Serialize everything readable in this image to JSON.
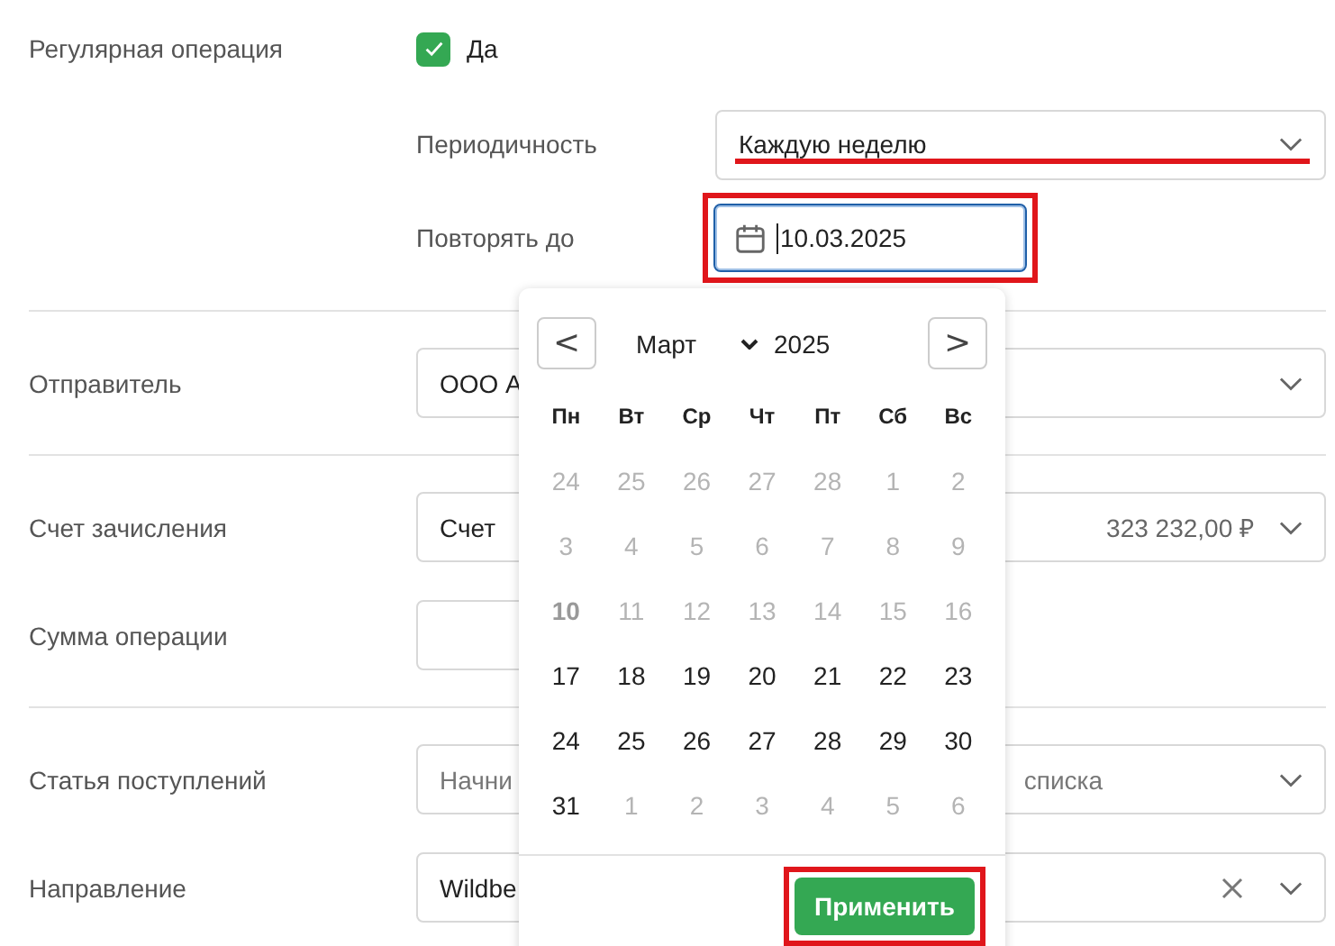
{
  "recurring": {
    "label": "Регулярная операция",
    "checkbox_label": "Да",
    "checked": true
  },
  "periodicity": {
    "label": "Периодичность",
    "value": "Каждую неделю",
    "highlighted": true
  },
  "repeat_until": {
    "label": "Повторять до",
    "value": "10.03.2025",
    "highlighted": true
  },
  "sender": {
    "label": "Отправитель",
    "value": "ООО А"
  },
  "account": {
    "label": "Счет зачисления",
    "value": "Счет",
    "balance": "323 232,00 ₽"
  },
  "amount": {
    "label": "Сумма операции"
  },
  "income_item": {
    "label": "Статья поступлений",
    "placeholder_start": "Начни",
    "placeholder_end": "списка"
  },
  "direction": {
    "label": "Направление",
    "value": "Wildbe"
  },
  "calendar": {
    "prev": "<",
    "month": "Март",
    "year": "2025",
    "next": ">",
    "weekdays": [
      "Пн",
      "Вт",
      "Ср",
      "Чт",
      "Пт",
      "Сб",
      "Вс"
    ],
    "weeks": [
      [
        {
          "day": "24",
          "disabled": true,
          "selected": false
        },
        {
          "day": "25",
          "disabled": true,
          "selected": false
        },
        {
          "day": "26",
          "disabled": true,
          "selected": false
        },
        {
          "day": "27",
          "disabled": true,
          "selected": false
        },
        {
          "day": "28",
          "disabled": true,
          "selected": false
        },
        {
          "day": "1",
          "disabled": true,
          "selected": false
        },
        {
          "day": "2",
          "disabled": true,
          "selected": false
        }
      ],
      [
        {
          "day": "3",
          "disabled": true,
          "selected": false
        },
        {
          "day": "4",
          "disabled": true,
          "selected": false
        },
        {
          "day": "5",
          "disabled": true,
          "selected": false
        },
        {
          "day": "6",
          "disabled": true,
          "selected": false
        },
        {
          "day": "7",
          "disabled": true,
          "selected": false
        },
        {
          "day": "8",
          "disabled": true,
          "selected": false
        },
        {
          "day": "9",
          "disabled": true,
          "selected": false
        }
      ],
      [
        {
          "day": "10",
          "disabled": true,
          "selected": true
        },
        {
          "day": "11",
          "disabled": true,
          "selected": false
        },
        {
          "day": "12",
          "disabled": true,
          "selected": false
        },
        {
          "day": "13",
          "disabled": true,
          "selected": false
        },
        {
          "day": "14",
          "disabled": true,
          "selected": false
        },
        {
          "day": "15",
          "disabled": true,
          "selected": false
        },
        {
          "day": "16",
          "disabled": true,
          "selected": false
        }
      ],
      [
        {
          "day": "17",
          "disabled": false,
          "selected": false
        },
        {
          "day": "18",
          "disabled": false,
          "selected": false
        },
        {
          "day": "19",
          "disabled": false,
          "selected": false
        },
        {
          "day": "20",
          "disabled": false,
          "selected": false
        },
        {
          "day": "21",
          "disabled": false,
          "selected": false
        },
        {
          "day": "22",
          "disabled": false,
          "selected": false
        },
        {
          "day": "23",
          "disabled": false,
          "selected": false
        }
      ],
      [
        {
          "day": "24",
          "disabled": false,
          "selected": false
        },
        {
          "day": "25",
          "disabled": false,
          "selected": false
        },
        {
          "day": "26",
          "disabled": false,
          "selected": false
        },
        {
          "day": "27",
          "disabled": false,
          "selected": false
        },
        {
          "day": "28",
          "disabled": false,
          "selected": false
        },
        {
          "day": "29",
          "disabled": false,
          "selected": false
        },
        {
          "day": "30",
          "disabled": false,
          "selected": false
        }
      ],
      [
        {
          "day": "31",
          "disabled": false,
          "selected": false
        },
        {
          "day": "1",
          "disabled": true,
          "selected": false
        },
        {
          "day": "2",
          "disabled": true,
          "selected": false
        },
        {
          "day": "3",
          "disabled": true,
          "selected": false
        },
        {
          "day": "4",
          "disabled": true,
          "selected": false
        },
        {
          "day": "5",
          "disabled": true,
          "selected": false
        },
        {
          "day": "6",
          "disabled": true,
          "selected": false
        }
      ]
    ],
    "apply": "Применить",
    "apply_highlighted": true
  }
}
